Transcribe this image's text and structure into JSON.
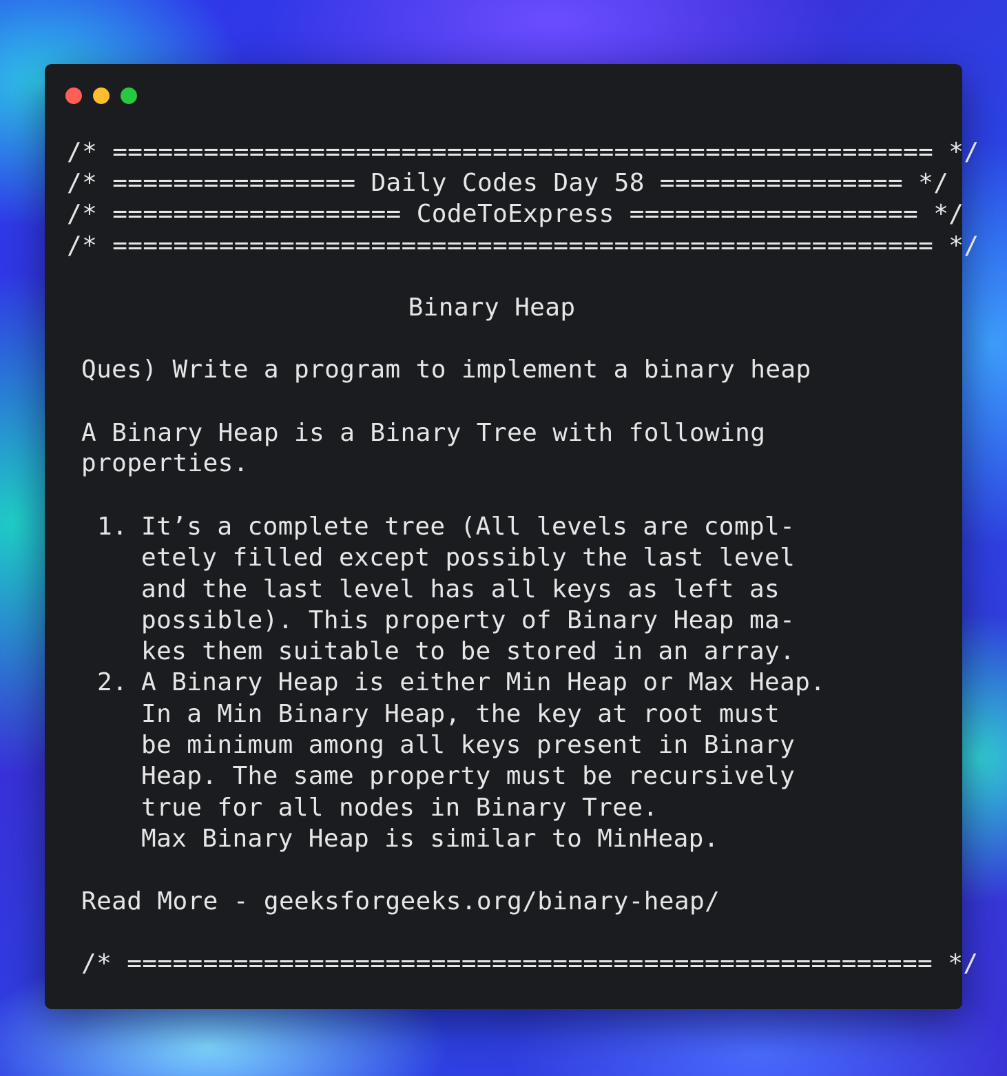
{
  "window": {
    "controls": [
      "close",
      "minimize",
      "maximize"
    ]
  },
  "banner": {
    "line1": "/* ====================================================== */",
    "line2": "/* ================ Daily Codes Day 58 ================ */",
    "line3": "/* =================== CodeToExpress =================== */",
    "line4": "/* ====================================================== */"
  },
  "content": {
    "title": "Binary Heap",
    "question": "Ques) Write a program to implement a binary heap",
    "intro_line1": "A Binary Heap is a Binary Tree with following",
    "intro_line2": "properties.",
    "items": [
      {
        "number": "1.",
        "lines": [
          "It’s a complete tree (All levels are compl-",
          "etely filled except possibly the last level",
          "and the last level has all keys as left as",
          "possible). This property of Binary Heap ma-",
          "kes them suitable to be stored in an array."
        ]
      },
      {
        "number": "2.",
        "lines": [
          "A Binary Heap is either Min Heap or Max Heap.",
          "In a Min Binary Heap, the key at root must",
          "be minimum among all keys present in Binary",
          "Heap. The same property must be recursively",
          "true for all nodes in Binary Tree.",
          "Max Binary Heap is similar to MinHeap."
        ]
      }
    ],
    "read_more": "Read More - geeksforgeeks.org/binary-heap/",
    "footer": "/* ===================================================== */"
  }
}
